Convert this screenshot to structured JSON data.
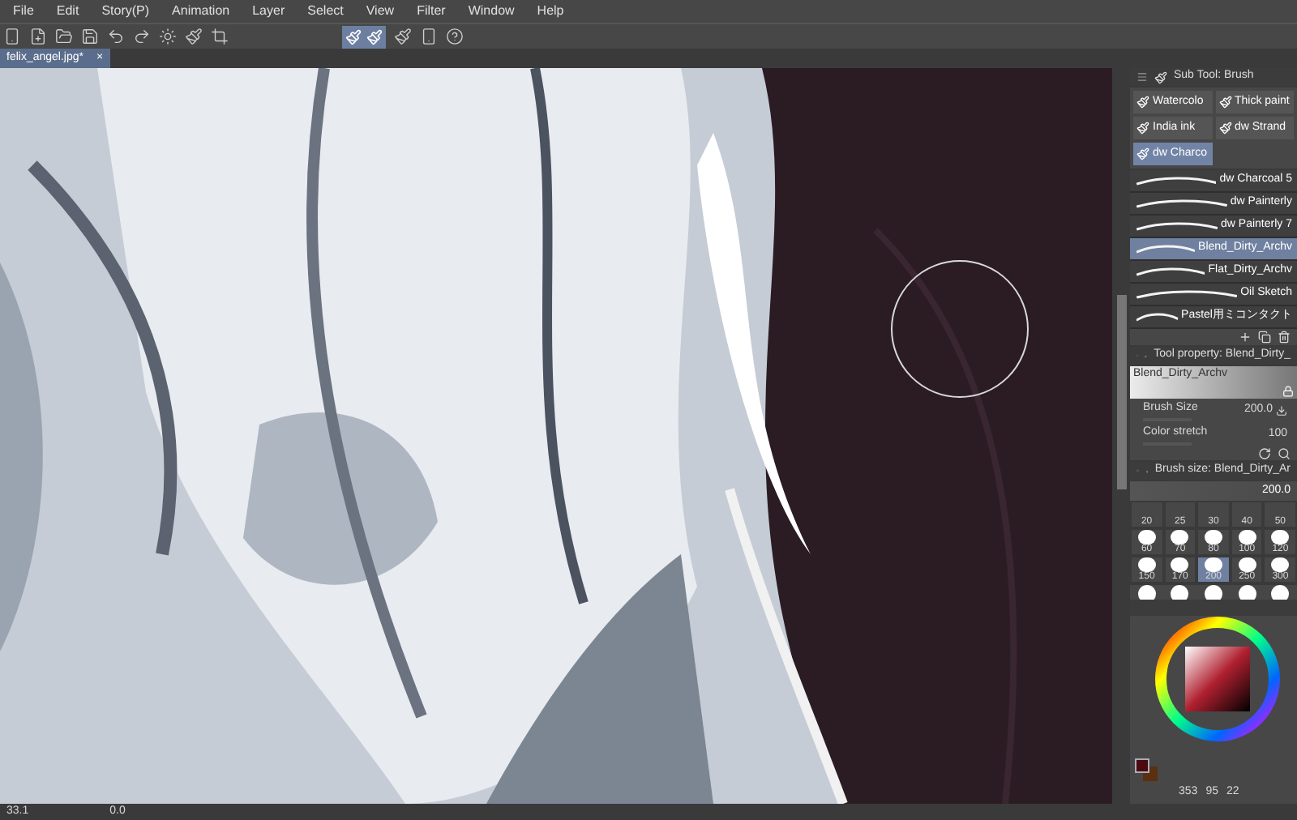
{
  "menu": [
    "File",
    "Edit",
    "Story(P)",
    "Animation",
    "Layer",
    "Select",
    "View",
    "Filter",
    "Window",
    "Help"
  ],
  "document_tab": {
    "label": "felix_angel.jpg*",
    "close": "×",
    "selected": true
  },
  "sub_tool": {
    "title": "Sub Tool: Brush",
    "groups": [
      {
        "label": "Watercolo",
        "selected": false
      },
      {
        "label": "Thick paint",
        "selected": false
      },
      {
        "label": "India ink",
        "selected": false
      },
      {
        "label": "dw Strand",
        "selected": false
      },
      {
        "label": "dw Charco",
        "selected": true
      }
    ],
    "brushes": [
      {
        "label": "dw Charcoal 5",
        "selected": false
      },
      {
        "label": "dw Painterly",
        "selected": false
      },
      {
        "label": "dw Painterly 7",
        "selected": false
      },
      {
        "label": "Blend_Dirty_Archv",
        "selected": true
      },
      {
        "label": "Flat_Dirty_Archv",
        "selected": false
      },
      {
        "label": "Oil Sketch",
        "selected": false
      },
      {
        "label": "Pastel用ミコンタクト",
        "selected": false
      }
    ]
  },
  "tool_property": {
    "title": "Tool property: Blend_Dirty_",
    "preview_label": "Blend_Dirty_Archv",
    "properties": [
      {
        "label": "Brush Size",
        "value": "200.0"
      },
      {
        "label": "Color stretch",
        "value": "100"
      }
    ]
  },
  "brush_size": {
    "title": "Brush size: Blend_Dirty_Ar",
    "value": "200.0",
    "sizes": [
      {
        "label": "20",
        "selected": false
      },
      {
        "label": "25",
        "selected": false
      },
      {
        "label": "30",
        "selected": false
      },
      {
        "label": "40",
        "selected": false
      },
      {
        "label": "50",
        "selected": false
      },
      {
        "label": "60",
        "selected": false
      },
      {
        "label": "70",
        "selected": false
      },
      {
        "label": "80",
        "selected": false
      },
      {
        "label": "100",
        "selected": false
      },
      {
        "label": "120",
        "selected": false
      },
      {
        "label": "150",
        "selected": false
      },
      {
        "label": "170",
        "selected": false
      },
      {
        "label": "200",
        "selected": true
      },
      {
        "label": "250",
        "selected": false
      },
      {
        "label": "300",
        "selected": false
      }
    ]
  },
  "color": {
    "readouts": [
      "353",
      "95",
      "22"
    ]
  },
  "pen_toggle": {
    "selected": true
  },
  "status_bar": {
    "zoom": "33.1",
    "angle": "0.0"
  }
}
